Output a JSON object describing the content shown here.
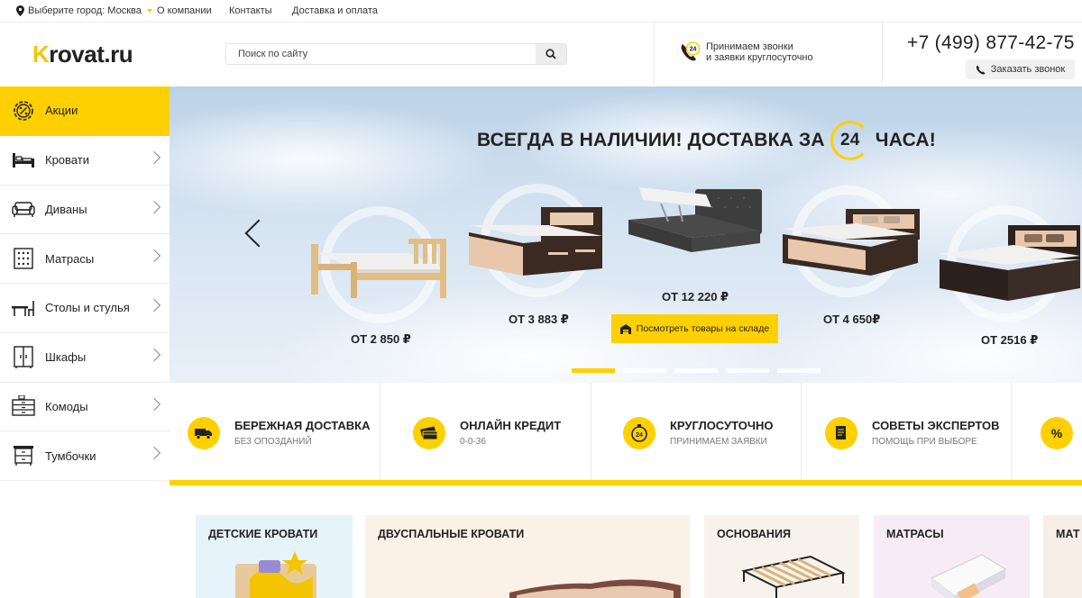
{
  "topbar": {
    "city": "Выберите город: Москва",
    "links": [
      "О компании",
      "Контакты",
      "Доставка и оплата"
    ]
  },
  "header": {
    "logo_k": "K",
    "logo_rest": "rovat.ru",
    "search_placeholder": "Поиск по сайту",
    "calls_line1": "Принимаем звонки",
    "calls_line2": "и заявки круглосуточно",
    "calls_badge": "24",
    "phone": "+7 (499) 877-42-75",
    "callback": "Заказать звонок"
  },
  "sidebar": {
    "items": [
      {
        "label": "Акции",
        "icon": "percent-gear-icon"
      },
      {
        "label": "Кровати",
        "icon": "bed-icon"
      },
      {
        "label": "Диваны",
        "icon": "sofa-icon"
      },
      {
        "label": "Матрасы",
        "icon": "mattress-icon"
      },
      {
        "label": "Столы и стулья",
        "icon": "table-chair-icon"
      },
      {
        "label": "Шкафы",
        "icon": "wardrobe-icon"
      },
      {
        "label": "Комоды",
        "icon": "dresser-icon"
      },
      {
        "label": "Тумбочки",
        "icon": "nightstand-icon"
      }
    ]
  },
  "banner": {
    "title_before": "ВСЕГДА В НАЛИЧИИ! ДОСТАВКА ЗА",
    "title_num": "24",
    "title_after": "ЧАСА!",
    "beds": [
      {
        "price": "ОТ 2 850 ₽"
      },
      {
        "price": "ОТ 3 883 ₽"
      },
      {
        "price": "ОТ 12 220 ₽"
      },
      {
        "price": "ОТ 4 650₽"
      },
      {
        "price": "ОТ 2516 ₽"
      }
    ],
    "stock_button": "Посмотреть товары на складе",
    "slides_total": 5,
    "slide_active": 1
  },
  "features": [
    {
      "title": "БЕРЕЖНАЯ ДОСТАВКА",
      "sub": "БЕЗ ОПОЗДАНИЙ",
      "icon": "truck-icon"
    },
    {
      "title": "ОНЛАЙН КРЕДИТ",
      "sub": "0-0-36",
      "icon": "credit-card-icon"
    },
    {
      "title": "КРУГЛОСУТОЧНО",
      "sub": "ПРИНИМАЕМ ЗАЯВКИ",
      "icon": "clock-24-icon",
      "badge": "24"
    },
    {
      "title": "СОВЕТЫ ЭКСПЕРТОВ",
      "sub": "ПОМОЩЬ ПРИ ВЫБОРЕ",
      "icon": "document-icon"
    },
    {
      "title": "",
      "sub": "",
      "icon": "percent-icon",
      "badge": "%"
    }
  ],
  "categories": [
    {
      "title": "ДЕТСКИЕ КРОВАТИ",
      "bg": "#e6f3fb"
    },
    {
      "title": "ДВУСПАЛЬНЫЕ КРОВАТИ",
      "bg": "#fbf1e7"
    },
    {
      "title": "ОСНОВАНИЯ",
      "bg": "#f7f2ec"
    },
    {
      "title": "МАТРАСЫ",
      "bg": "#f7ecf5"
    },
    {
      "title": "МАТ",
      "bg": "#f7eee7"
    }
  ],
  "colors": {
    "accent": "#ffd000",
    "text": "#222222"
  }
}
